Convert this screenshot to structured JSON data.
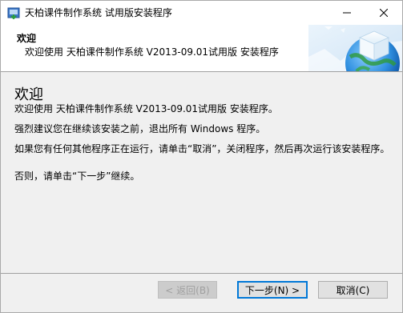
{
  "window": {
    "title": "天柏课件制作系统 试用版安装程序",
    "icon": "installer-app-icon"
  },
  "header": {
    "title": "欢迎",
    "subtitle": "欢迎使用 天柏课件制作系统 V2013-09.01试用版 安装程序",
    "image": "globe-cube-banner"
  },
  "content": {
    "heading": "欢迎",
    "paragraphs": [
      "欢迎使用 天柏课件制作系统 V2013-09.01试用版 安装程序。",
      "强烈建议您在继续该安装之前，退出所有 Windows 程序。",
      "如果您有任何其他程序正在运行，请单击“取消”，关闭程序，然后再次运行该安装程序。",
      "否则，请单击“下一步”继续。"
    ]
  },
  "buttons": {
    "back": "< 返回(B)",
    "next": "下一步(N) >",
    "cancel": "取消(C)"
  },
  "colors": {
    "content_bg": "#f0f0f0",
    "default_button_border": "#0078d7",
    "disabled_text": "#a0a0a0"
  }
}
